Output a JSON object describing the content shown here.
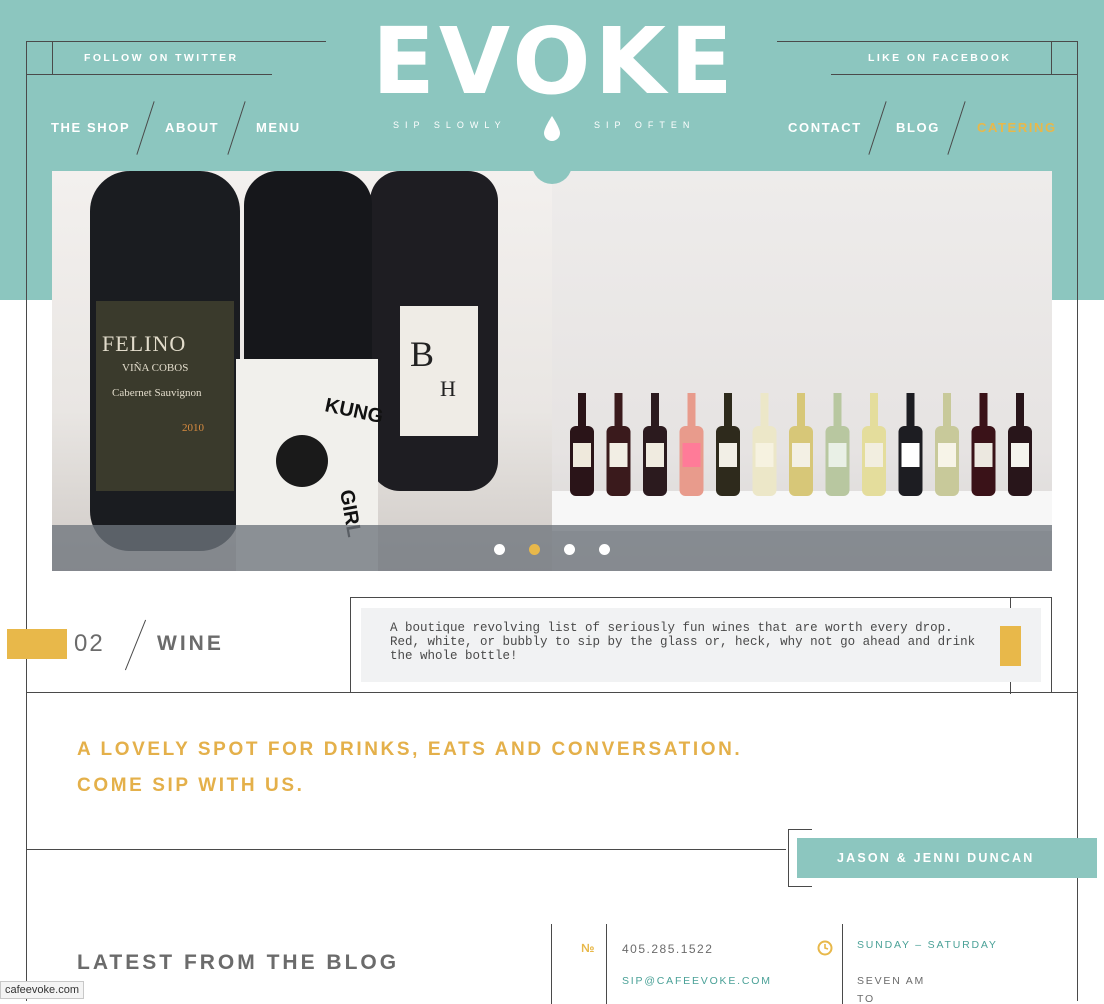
{
  "header": {
    "logo_text": "EVOKE",
    "tagline_left": "SIP SLOWLY",
    "tagline_right": "SIP OFTEN",
    "social_left": "FOLLOW ON TWITTER",
    "social_right": "LIKE ON FACEBOOK"
  },
  "nav": {
    "left": [
      "THE SHOP",
      "ABOUT",
      "MENU"
    ],
    "right": [
      "CONTACT",
      "BLOG",
      "CATERING"
    ],
    "active": "CATERING"
  },
  "slider": {
    "dots": 4,
    "active_dot": 2,
    "left_image": "Wine bottles close-up (Felino, Kung Fu Girl, Box)",
    "right_image": "Row of wine bottles on a shelf"
  },
  "feature": {
    "number": "02",
    "title": "WINE",
    "description": "A boutique revolving list of seriously fun wines that are worth every drop. Red, white, or bubbly to sip by the glass or, heck, why not go ahead and drink the whole bottle!"
  },
  "intro": {
    "line1": "A LOVELY SPOT FOR DRINKS, EATS AND CONVERSATION.",
    "line2": "COME SIP WITH US.",
    "owners": "JASON & JENNI DUNCAN"
  },
  "blog": {
    "title": "LATEST FROM THE BLOG"
  },
  "contact": {
    "number_icon": "№",
    "phone": "405.285.1522",
    "email": "SIP@CAFEEVOKE.COM",
    "days": "SUNDAY – SATURDAY",
    "hours_open": "SEVEN AM",
    "hours_to": "TO"
  },
  "status_bar": {
    "url": "cafeevoke.com"
  },
  "colors": {
    "teal": "#8cc6bf",
    "gold": "#e8b84a",
    "gray_text": "#6b6b6b",
    "line": "#4a4a4a"
  }
}
